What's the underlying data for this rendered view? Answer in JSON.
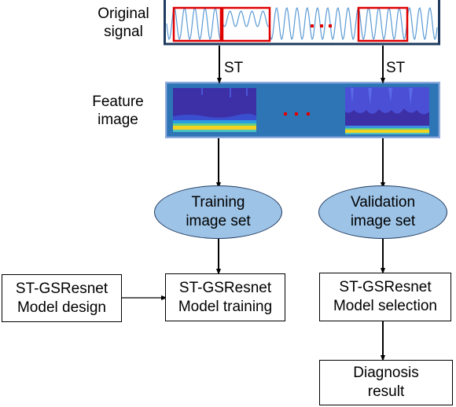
{
  "rows": {
    "original_signal": {
      "line1": "Original",
      "line2": "signal"
    },
    "feature_image": {
      "line1": "Feature",
      "line2": "image"
    }
  },
  "transforms": {
    "left": "ST",
    "right": "ST"
  },
  "ellipses": {
    "training": {
      "line1": "Training",
      "line2": "image set"
    },
    "validation": {
      "line1": "Validation",
      "line2": "image set"
    }
  },
  "boxes": {
    "design": {
      "line1": "ST-GSResnet",
      "line2": "Model design"
    },
    "training": {
      "line1": "ST-GSResnet",
      "line2": "Model training"
    },
    "selection": {
      "line1": "ST-GSResnet",
      "line2": "Model selection"
    },
    "diagnosis": {
      "line1": "Diagnosis",
      "line2": "result"
    }
  },
  "colors": {
    "signal_frame": "#1f3a5f",
    "signal_wave": "#5b9bd5",
    "window_highlight": "#e00000",
    "feature_frame": "#2e75b6",
    "feature_frame_border": "#8faadc",
    "ellipse_fill": "#9dc3e6",
    "ellipsis_dots": "#e00000"
  }
}
